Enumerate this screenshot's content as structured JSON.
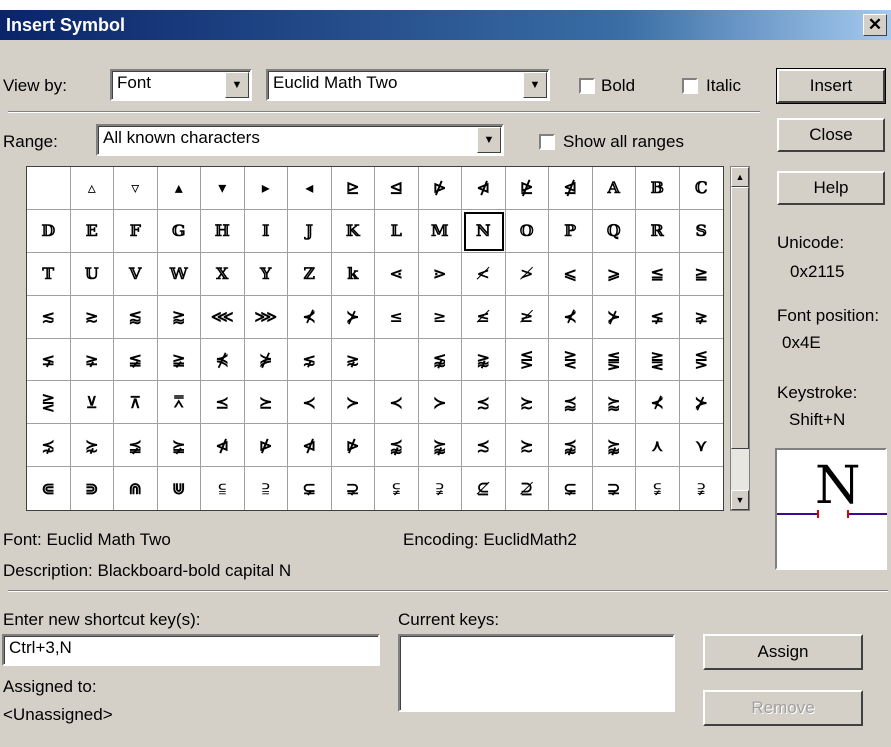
{
  "title": "Insert Symbol",
  "close_glyph": "✕",
  "view_by": {
    "label": "View by:",
    "mode": "Font",
    "font": "Euclid Math Two"
  },
  "bold": {
    "label": "Bold",
    "checked": false
  },
  "italic": {
    "label": "Italic",
    "checked": false
  },
  "range": {
    "label": "Range:",
    "value": "All known characters"
  },
  "show_all_ranges": {
    "label": "Show all ranges",
    "checked": false
  },
  "buttons": {
    "insert": "Insert",
    "close": "Close",
    "help": "Help",
    "assign": "Assign",
    "remove": "Remove"
  },
  "info": {
    "unicode_label": "Unicode:",
    "unicode_value": "0x2115",
    "font_position_label": "Font position:",
    "font_position_value": "0x4E",
    "keystroke_label": "Keystroke:",
    "keystroke_value": "Shift+N"
  },
  "preview_char": "N",
  "font_line": "Font:  Euclid Math Two",
  "encoding_line": "Encoding:  EuclidMath2",
  "description_line": "Description:  Blackboard-bold capital N",
  "shortcut": {
    "enter_label": "Enter new shortcut key(s):",
    "value": "Ctrl+3,N",
    "current_label": "Current keys:",
    "assigned_to_label": "Assigned to:",
    "assigned_to_value": "<Unassigned>"
  },
  "selected_index": 26,
  "grid": [
    "",
    "▵",
    "▿",
    "▴",
    "▾",
    "▸",
    "◂",
    "⊵",
    "⊴",
    "⋫",
    "⋪",
    "⋭",
    "⋬",
    "𝔸",
    "𝔹",
    "ℂ",
    "𝔻",
    "𝔼",
    "𝔽",
    "𝔾",
    "ℍ",
    "𝕀",
    "𝕁",
    "𝕂",
    "𝕃",
    "𝕄",
    "ℕ",
    "𝕆",
    "ℙ",
    "ℚ",
    "ℝ",
    "𝕊",
    "𝕋",
    "𝕌",
    "𝕍",
    "𝕎",
    "𝕏",
    "𝕐",
    "ℤ",
    "𝕜",
    "⋖",
    "⋗",
    "≮",
    "≯",
    "⩽",
    "⩾",
    "≦",
    "≧",
    "≲",
    "≳",
    "⪅",
    "⪆",
    "⋘",
    "⋙",
    "⊀",
    "⊁",
    "≤",
    "≥",
    "≰",
    "≱",
    "⊀",
    "⊁",
    "⪇",
    "⪈",
    "⪇",
    "⪈",
    "≨",
    "≩",
    "⋠",
    "⋡",
    "⋦",
    "⋧",
    "",
    "⪉",
    "⪊",
    "⋚",
    "⋛",
    "⪋",
    "⪌",
    "⋚",
    "⋛",
    "⊻",
    "⊼",
    "⩞",
    "⪯",
    "⪰",
    "≺",
    "≻",
    "≺",
    "≻",
    "≾",
    "≿",
    "⪷",
    "⪸",
    "⊀",
    "⊁",
    "⋨",
    "⋩",
    "⪵",
    "⪶",
    "⋪",
    "⋫",
    "⋪",
    "⋫",
    "⪹",
    "⪺",
    "≾",
    "≿",
    "⪹",
    "⪺",
    "⋏",
    "⋎",
    "⋐",
    "⋑",
    "⋒",
    "⋓",
    "⫅",
    "⫆",
    "⊊",
    "⊋",
    "⫋",
    "⫌",
    "⊈",
    "⊉",
    "⊊",
    "⊋",
    "⫋",
    "⫌"
  ]
}
